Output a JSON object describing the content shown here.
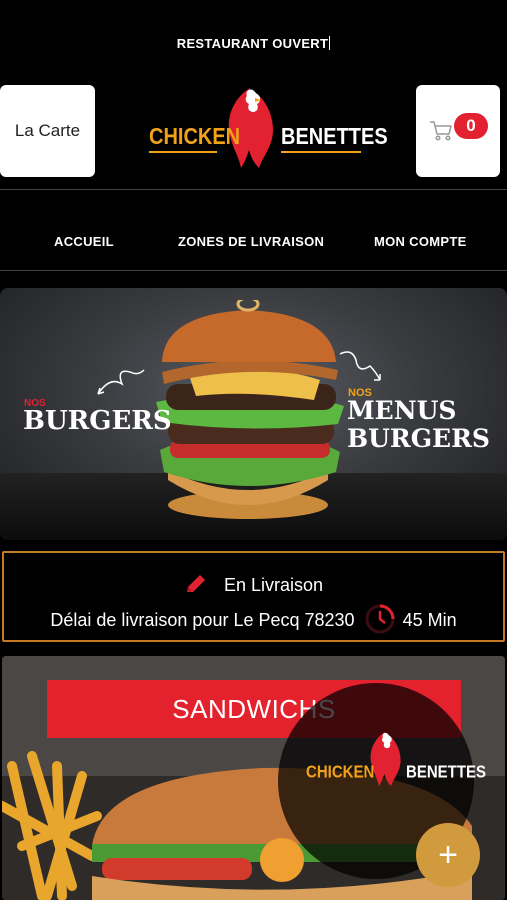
{
  "header": {
    "status_text": "RESTAURANT OUVERT",
    "menu_button_label": "La Carte",
    "cart_count": "0",
    "logo_left": "CHICKEN",
    "logo_right": "BENETTES"
  },
  "nav": {
    "items": [
      {
        "label": "ACCUEIL"
      },
      {
        "label": "ZONES DE LIVRAISON"
      },
      {
        "label": "MON COMPTE"
      }
    ]
  },
  "hero": {
    "left_small": "NOS",
    "left_big": "BURGERS",
    "right_small": "NOS",
    "right_big_1": "MENUS",
    "right_big_2": "BURGERS"
  },
  "delivery": {
    "mode": "En Livraison",
    "delay_text": "Délai de livraison pour Le Pecq 78230",
    "delay_value": "45 Min"
  },
  "category": {
    "title": "SANDWICHS"
  },
  "overlay_logo": {
    "left": "CHICKEN",
    "right": "BENETTES"
  },
  "fab": {
    "label": "+"
  },
  "colors": {
    "accent_red": "#e22230",
    "accent_orange": "#f2a21a",
    "border_brown": "#c47a22",
    "fab": "#d19a3d"
  }
}
